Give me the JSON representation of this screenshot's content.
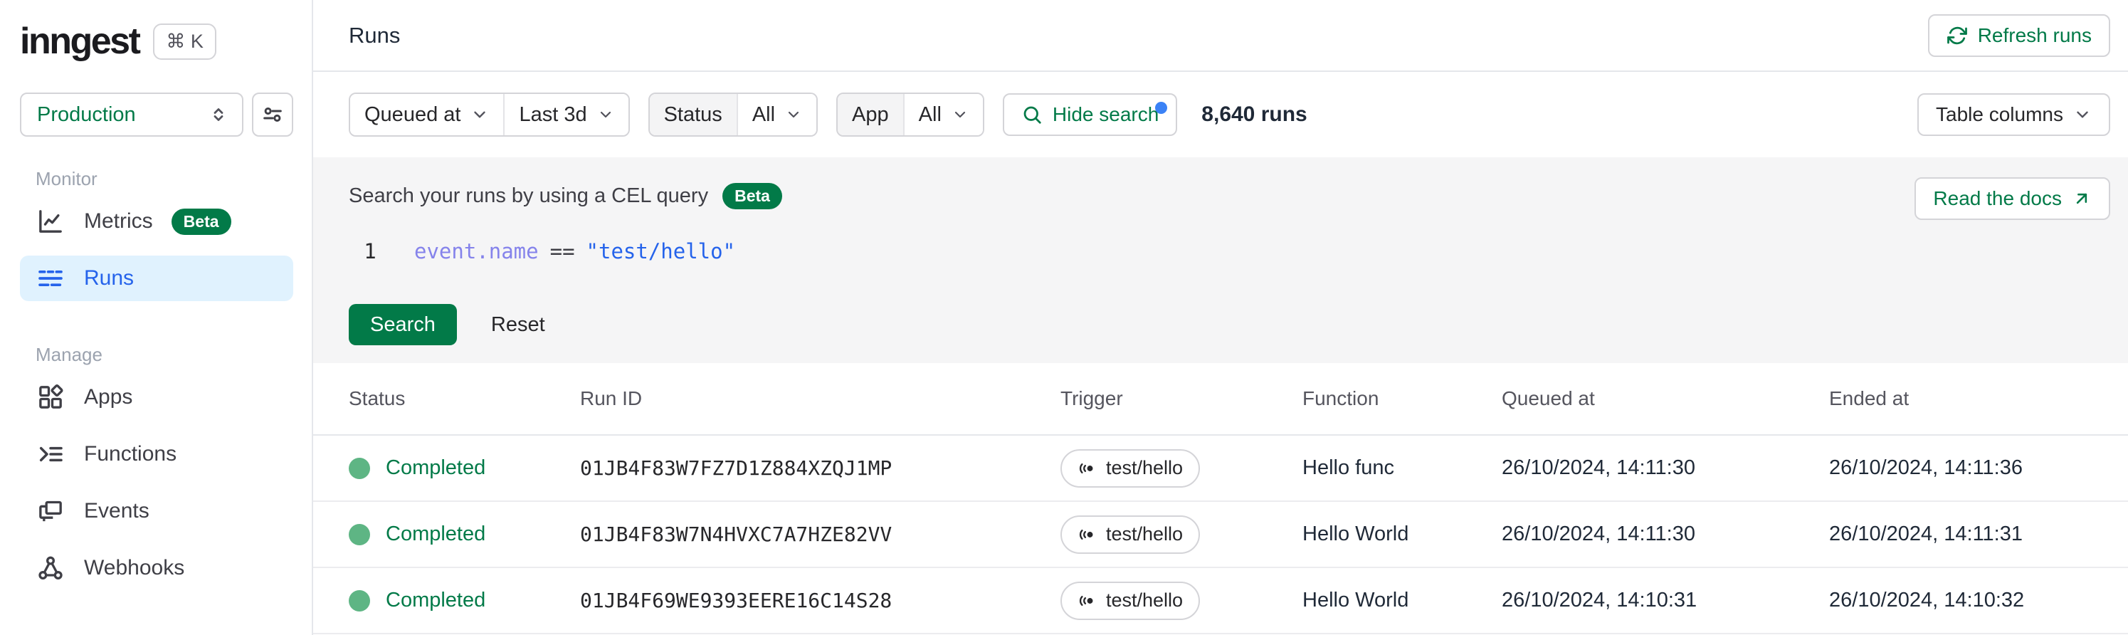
{
  "colors": {
    "accent_green": "#027a48",
    "active_blue": "#2563eb",
    "active_item_bg": "#e0f2fe",
    "status_dot_green": "#5eb584",
    "notification_blue": "#3b82f6",
    "code_purple": "#8583eb",
    "code_string_blue": "#2563eb",
    "panel_gray": "#f5f5f6"
  },
  "brand": {
    "logo": "inngest",
    "shortcut_badge": "⌘ K"
  },
  "sidebar": {
    "environment_selector": {
      "value": "Production"
    },
    "monitor_section_label": "Monitor",
    "manage_section_label": "Manage",
    "metrics_label": "Metrics",
    "metrics_badge": "Beta",
    "runs_label": "Runs",
    "apps_label": "Apps",
    "functions_label": "Functions",
    "events_label": "Events",
    "webhooks_label": "Webhooks"
  },
  "header": {
    "title": "Runs",
    "refresh_button": "Refresh runs"
  },
  "filters": {
    "time_field": "Queued at",
    "time_range": "Last 3d",
    "status_label": "Status",
    "status_value": "All",
    "app_label": "App",
    "app_value": "All",
    "search_toggle": "Hide search",
    "runs_count": "8,640 runs",
    "table_columns_button": "Table columns"
  },
  "search_panel": {
    "title": "Search your runs by using a CEL query",
    "beta_badge": "Beta",
    "docs_button": "Read the docs",
    "line_number": "1",
    "code": {
      "object_path": "event.name",
      "operator": "==",
      "value": "\"test/hello\""
    },
    "search_button": "Search",
    "reset_button": "Reset"
  },
  "table": {
    "columns": {
      "status": "Status",
      "run_id": "Run ID",
      "trigger": "Trigger",
      "function": "Function",
      "queued_at": "Queued at",
      "ended_at": "Ended at"
    },
    "rows": [
      {
        "status": "Completed",
        "run_id": "01JB4F83W7FZ7D1Z884XZQJ1MP",
        "trigger": "test/hello",
        "function": "Hello func",
        "queued_at": "26/10/2024, 14:11:30",
        "ended_at": "26/10/2024, 14:11:36"
      },
      {
        "status": "Completed",
        "run_id": "01JB4F83W7N4HVXC7A7HZE82VV",
        "trigger": "test/hello",
        "function": "Hello World",
        "queued_at": "26/10/2024, 14:11:30",
        "ended_at": "26/10/2024, 14:11:31"
      },
      {
        "status": "Completed",
        "run_id": "01JB4F69WE9393EERE16C14S28",
        "trigger": "test/hello",
        "function": "Hello World",
        "queued_at": "26/10/2024, 14:10:31",
        "ended_at": "26/10/2024, 14:10:32"
      }
    ]
  }
}
